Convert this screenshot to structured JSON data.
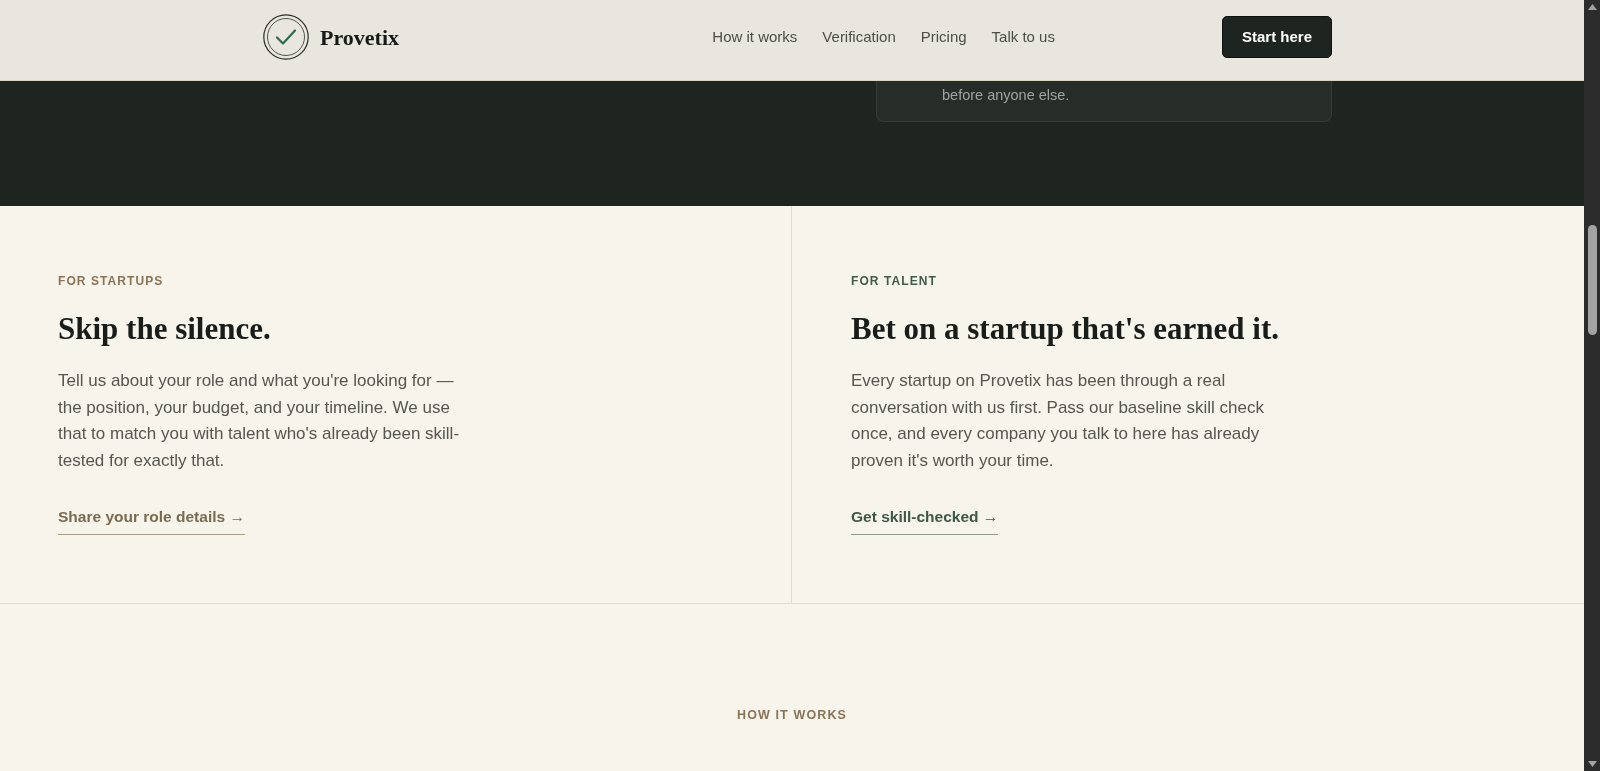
{
  "header": {
    "brand": "Provetix",
    "nav": [
      "How it works",
      "Verification",
      "Pricing",
      "Talk to us"
    ],
    "button": "Start here"
  },
  "top_card": {
    "text": "before anyone else."
  },
  "audiences": [
    {
      "kind": "startups",
      "eyebrow": "FOR STARTUPS",
      "title": "Skip the silence.",
      "body": "Tell us about your role and what you're looking for — the position, your budget, and your timeline. We use that to match you with talent who's already been skill-tested for exactly that.",
      "link": "Share your role details →"
    },
    {
      "kind": "talent",
      "eyebrow": "FOR TALENT",
      "title": "Bet on a startup that's earned it.",
      "body": "Every startup on Provetix has been through a real conversation with us first. Pass our baseline skill check once, and every company you talk to here has already proven it's worth your time.",
      "link": "Get skill-checked →"
    }
  ],
  "how_it_works": {
    "eyebrow": "HOW IT WORKS"
  }
}
